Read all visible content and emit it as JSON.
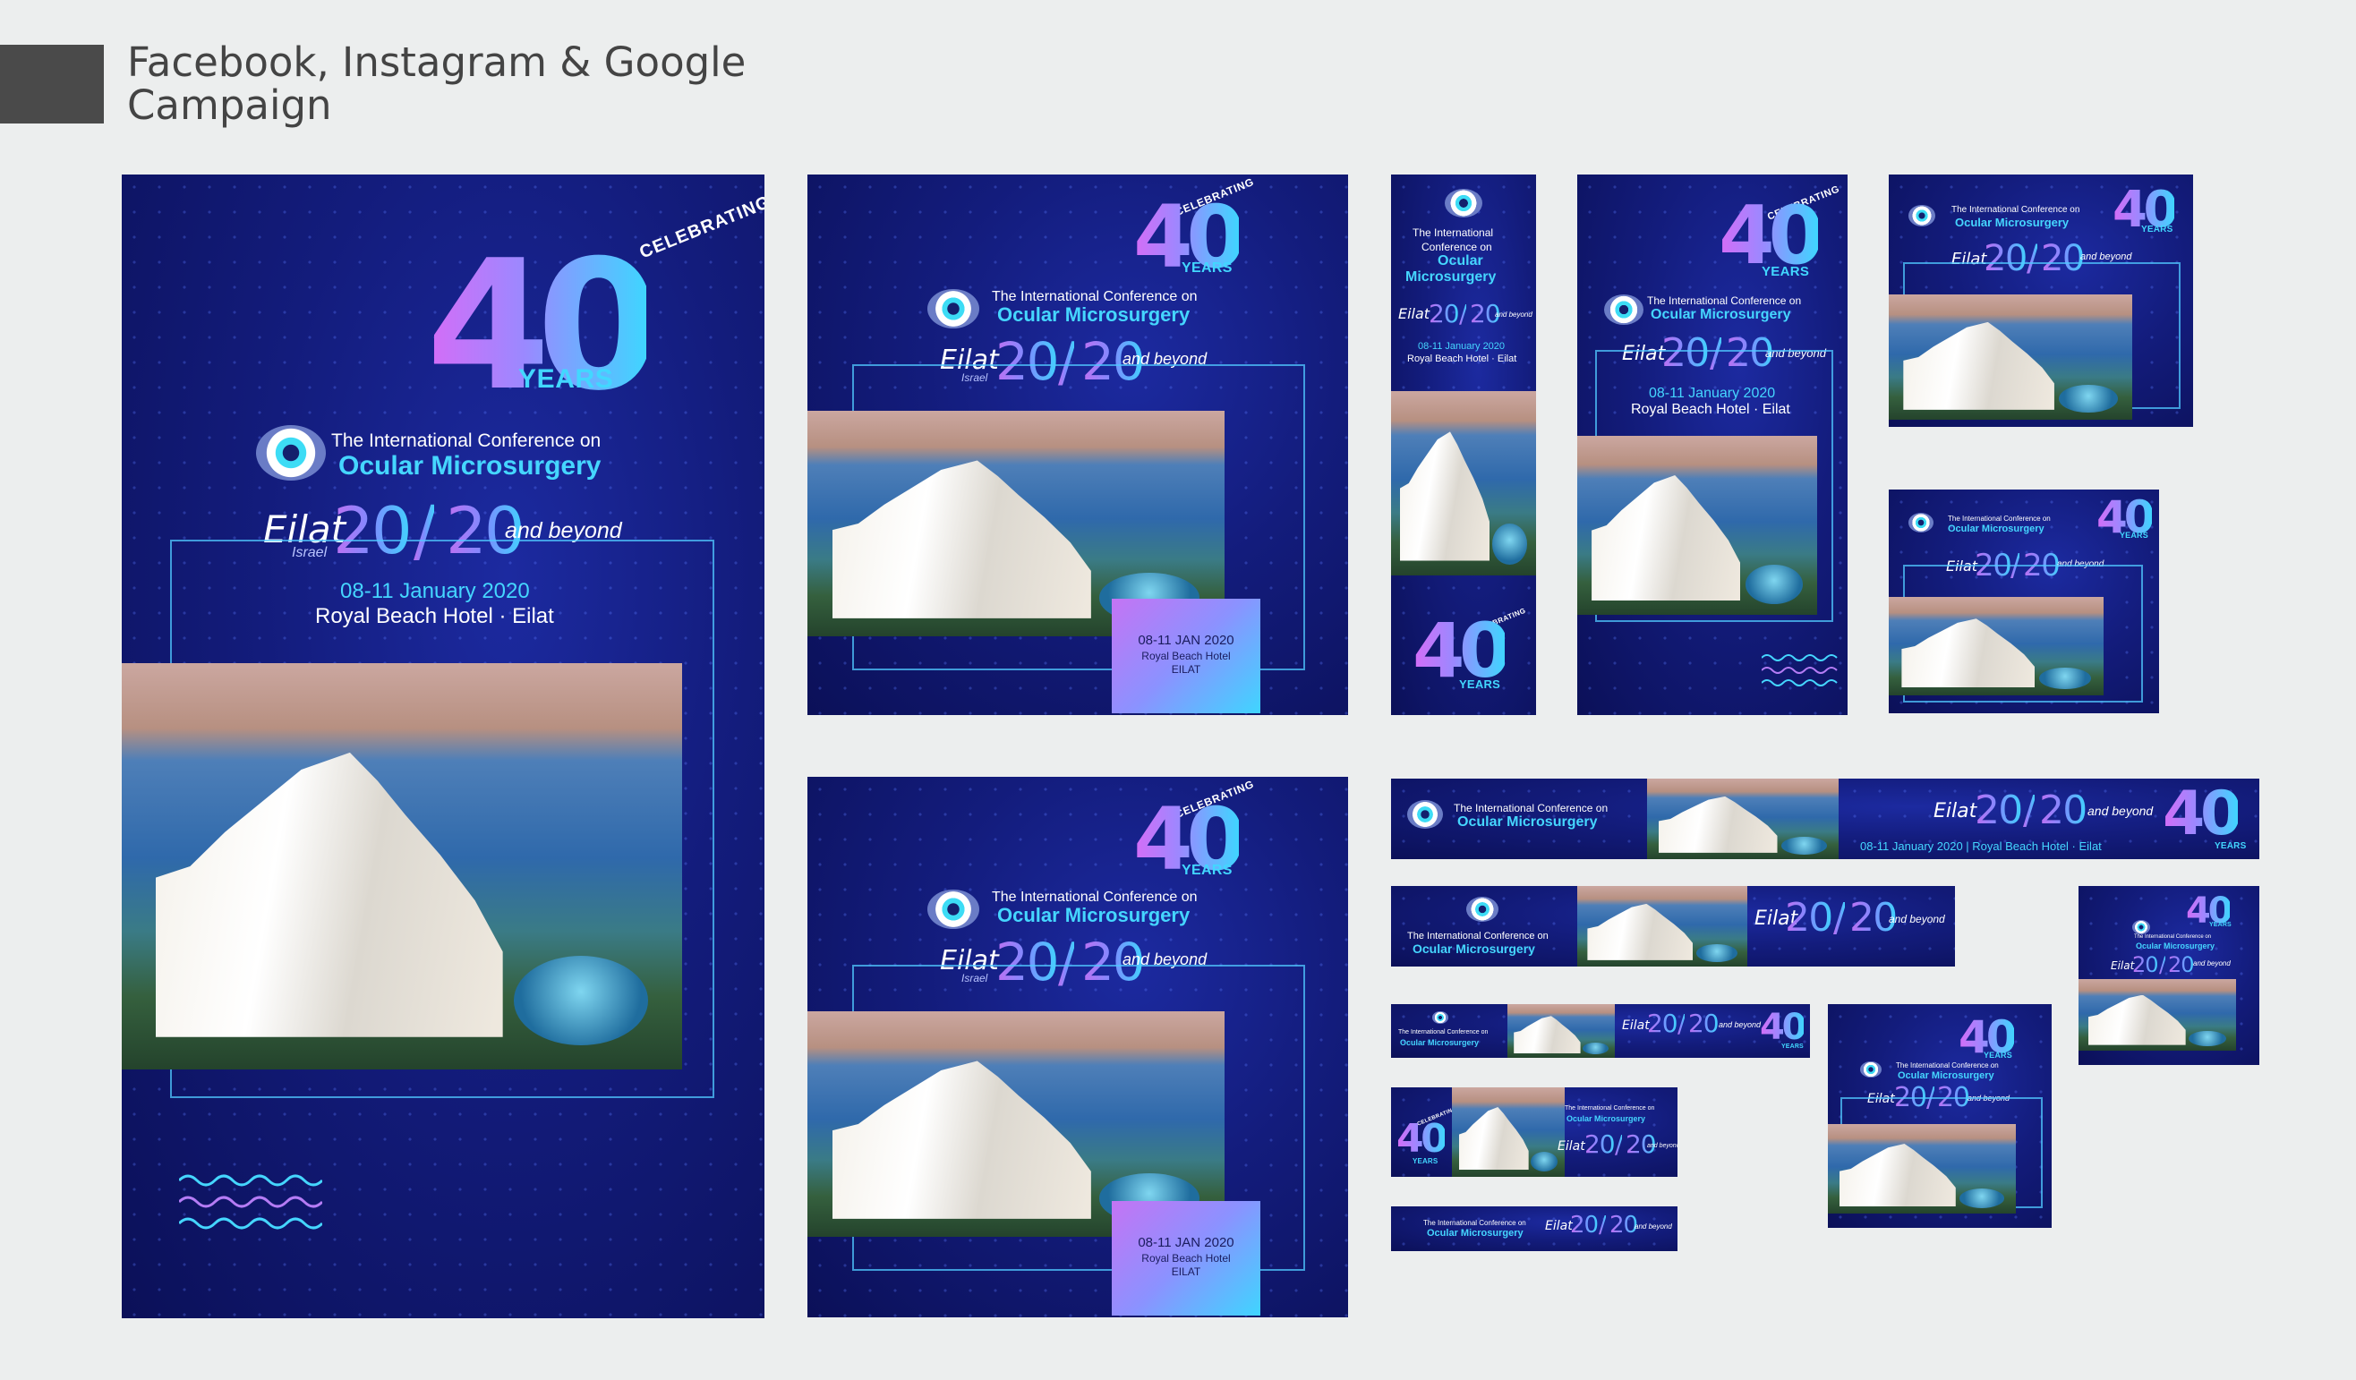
{
  "page": {
    "title": "Facebook, Instagram & Google\nCampaign"
  },
  "brand": {
    "celebrating": "CELEBRATING",
    "forty": "40",
    "years": "YEARS",
    "conf_line": "The International Conference on",
    "conf_name": "Ocular Microsurgery",
    "conf_line_short": "The International",
    "conf_line_short2": "Conference on",
    "conf_name_a": "Ocular",
    "conf_name_b": "Microsurgery",
    "eilat": "Eilat",
    "israel": "Israel",
    "twenty_a": "20",
    "slash": "/",
    "twenty_b": "20",
    "beyond": "and beyond",
    "date_long": "08-11 January 2020",
    "venue": "Royal Beach Hotel · Eilat",
    "date_line_banner": "08-11 January 2020 | Royal Beach Hotel · Eilat",
    "date_short": "08-11 JAN 2020",
    "venue_short": "Royal Beach Hotel",
    "city": "EILAT"
  },
  "colors": {
    "navy": "#131c7c",
    "cyan": "#45d6ff",
    "violet": "#c474f4",
    "background": "#eceeee"
  },
  "icons": [
    "eye-logo-icon",
    "wave-icon",
    "hotel-photo"
  ]
}
